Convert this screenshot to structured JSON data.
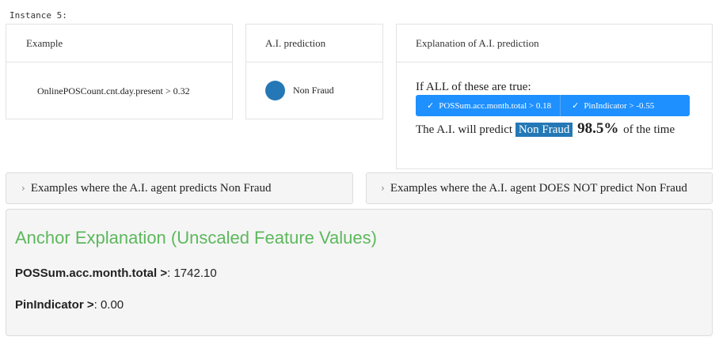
{
  "instance_title": "Instance 5:",
  "example_card": {
    "header": "Example",
    "feature": "OnlinePOSCount.cnt.day.present > 0.32"
  },
  "prediction_card": {
    "header": "A.I. prediction",
    "label": "Non Fraud",
    "dot_color": "#2478b5"
  },
  "explanation_card": {
    "header": "Explanation of A.I. prediction",
    "if_text": "If ALL of these are true:",
    "conditions": [
      {
        "icon": "check-icon",
        "text": "POSSum.acc.month.total > 0.18"
      },
      {
        "icon": "check-icon",
        "text": "PinIndicator > -0.55"
      }
    ],
    "result_prefix": "The A.I. will predict",
    "result_label": "Non Fraud",
    "result_pct": "98.5%",
    "result_suffix": "of the time",
    "chip_color": "#1e90ff"
  },
  "accordions": [
    {
      "icon": "chevron-right-icon",
      "label": "Examples where the A.I. agent predicts Non Fraud"
    },
    {
      "icon": "chevron-right-icon",
      "label": "Examples where the A.I. agent DOES NOT predict Non Fraud"
    }
  ],
  "anchor_panel": {
    "title": "Anchor Explanation (Unscaled Feature Values)",
    "title_color": "#5cb85c",
    "rows": [
      {
        "name": "POSSum.acc.month.total >",
        "value": ": 1742.10"
      },
      {
        "name": "PinIndicator >",
        "value": ": 0.00"
      }
    ]
  }
}
